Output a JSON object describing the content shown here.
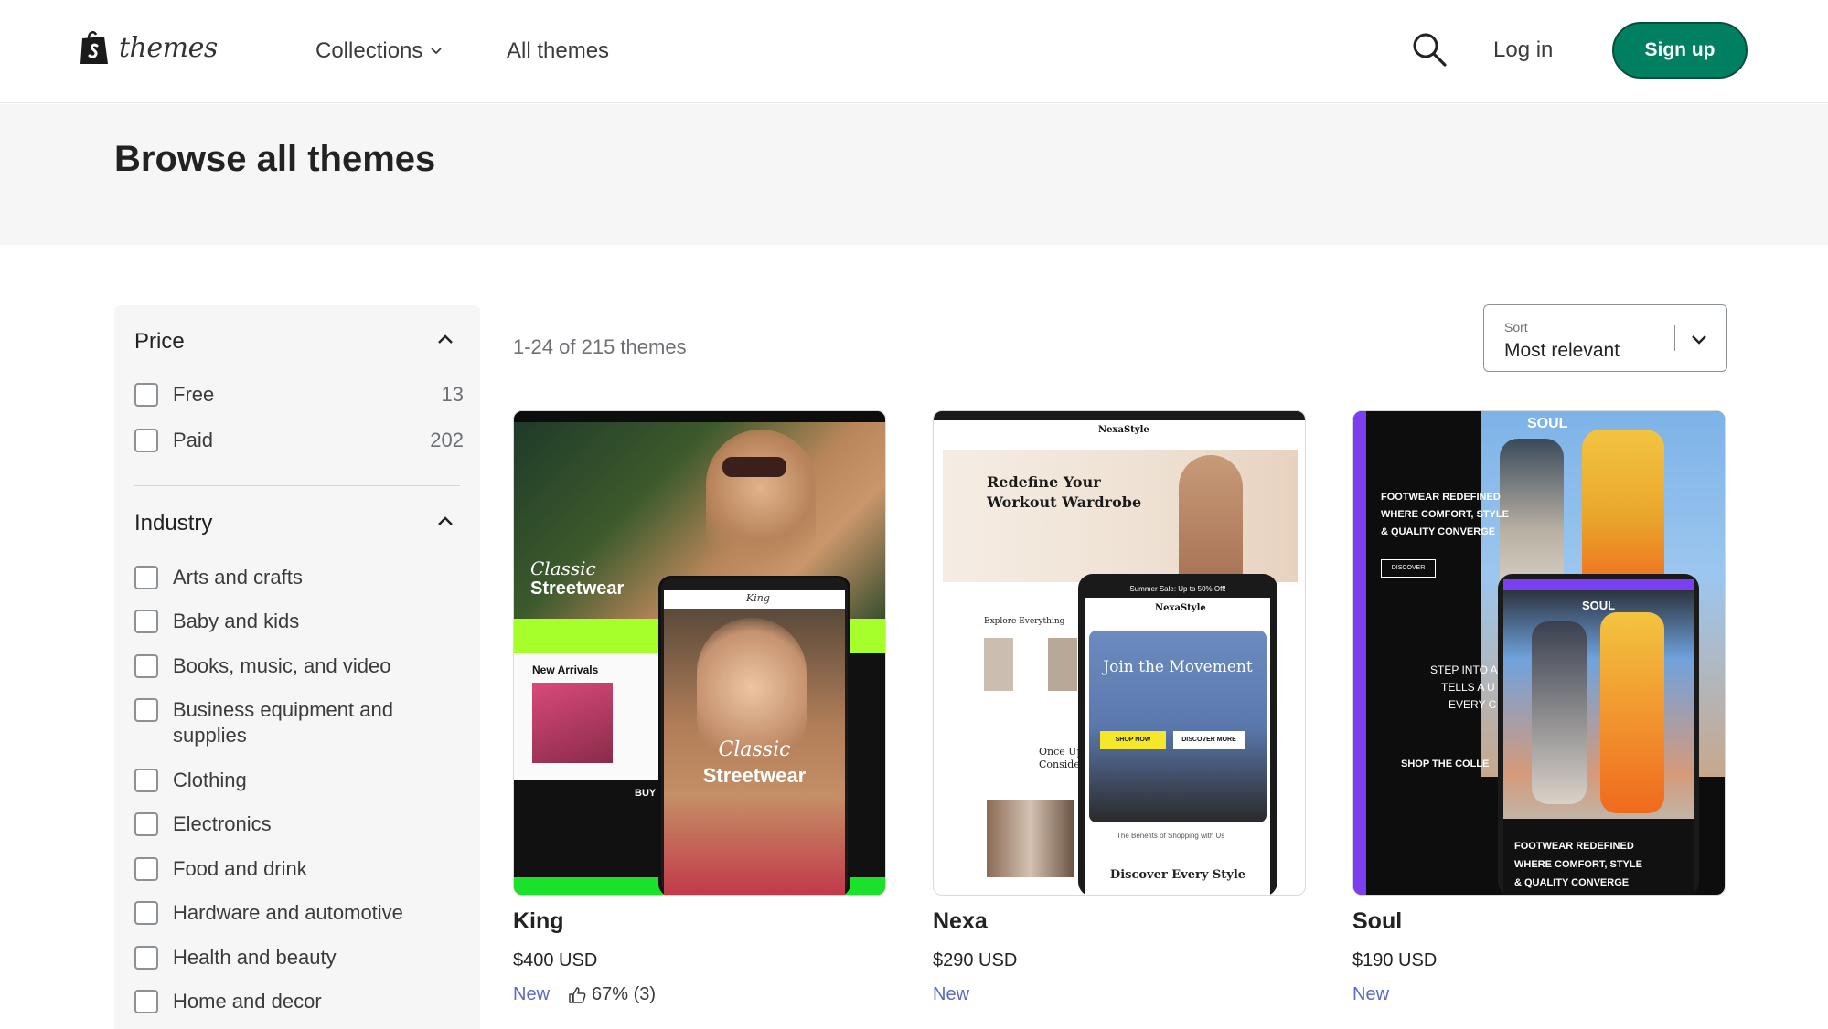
{
  "header": {
    "logo_text": "themes",
    "nav": {
      "collections": "Collections",
      "all_themes": "All themes"
    },
    "login": "Log in",
    "signup": "Sign up",
    "colors": {
      "signup_bg": "#008060"
    }
  },
  "hero": {
    "title": "Browse all themes"
  },
  "filters": {
    "price": {
      "title": "Price",
      "options": [
        {
          "label": "Free",
          "count": "13"
        },
        {
          "label": "Paid",
          "count": "202"
        }
      ]
    },
    "industry": {
      "title": "Industry",
      "options": [
        {
          "label": "Arts and crafts"
        },
        {
          "label": "Baby and kids"
        },
        {
          "label": "Books, music, and video"
        },
        {
          "label": "Business equipment and supplies"
        },
        {
          "label": "Clothing"
        },
        {
          "label": "Electronics"
        },
        {
          "label": "Food and drink"
        },
        {
          "label": "Hardware and automotive"
        },
        {
          "label": "Health and beauty"
        },
        {
          "label": "Home and decor"
        }
      ]
    }
  },
  "results": {
    "count": "1-24 of 215 themes",
    "sort_label": "Sort",
    "sort_value": "Most relevant"
  },
  "themes": [
    {
      "name": "King",
      "price": "$400 USD",
      "badge": "New",
      "rating": "67% (3)",
      "preview": {
        "headline_line1": "Classic",
        "headline_line2": "Streetwear",
        "section": "New Arrivals",
        "logo": "King",
        "buy": "BUY"
      }
    },
    {
      "name": "Nexa",
      "price": "$290 USD",
      "badge": "New",
      "preview": {
        "brand": "NexaStyle",
        "headline_line1": "Redefine Your",
        "headline_line2": "Workout Wardrobe",
        "promo": "Summer Sale: Up to 50% Off!",
        "mobile_headline": "Join the Movement",
        "shop_now": "SHOP NOW",
        "discover_more": "DISCOVER MORE",
        "explore": "Explore Everything",
        "discover_style": "Discover Every Style",
        "once": "Once Up",
        "consider": "Consider",
        "benefits": "The Benefits of Shopping with Us"
      }
    },
    {
      "name": "Soul",
      "price": "$190 USD",
      "badge": "New",
      "preview": {
        "brand": "SOUL",
        "headline_line1": "FOOTWEAR REDEFINED",
        "headline_line2": "WHERE COMFORT, STYLE",
        "headline_line3": "& QUALITY CONVERGE",
        "discover": "DISCOVER",
        "step1": "STEP INTO A",
        "step2": "TELLS A U",
        "step3": "EVERY C",
        "shop": "SHOP THE COLLE"
      }
    }
  ]
}
